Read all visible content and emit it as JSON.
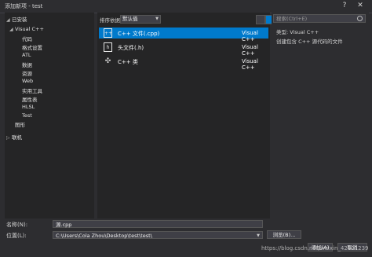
{
  "window": {
    "title": "添加新项 - test",
    "help_glyph": "?",
    "close_glyph": "✕"
  },
  "tree": {
    "installed": "已安装",
    "visual_cpp": "Visual C++",
    "children": [
      "代码",
      "格式设置",
      "ATL",
      "数据",
      "资源",
      "Web",
      "实用工具",
      "属性表",
      "HLSL",
      "Test"
    ],
    "graphics": "图形",
    "online": "联机"
  },
  "toolbar": {
    "sort_label": "排序依据:",
    "sort_value": "默认值"
  },
  "templates": [
    {
      "icon": "cpp-file-icon",
      "glyph": "++",
      "name": "C++ 文件(.cpp)",
      "type": "Visual C++",
      "selected": true
    },
    {
      "icon": "header-file-icon",
      "glyph": "h",
      "name": "头文件(.h)",
      "type": "Visual C++",
      "selected": false
    },
    {
      "icon": "cpp-class-icon",
      "glyph": "✣",
      "name": "C++ 类",
      "type": "Visual C++",
      "selected": false
    }
  ],
  "search": {
    "placeholder": "搜索(Ctrl+E)"
  },
  "details": {
    "type_line": "类型:  Visual C++",
    "description": "创建包含 C++ 源代码的文件"
  },
  "form": {
    "name_label": "名称(N):",
    "name_value": "源.cpp",
    "location_label": "位置(L):",
    "location_value": "C:\\Users\\Cola Zhou\\Desktop\\test\\test\\",
    "browse_label": "浏览(B)...",
    "add_label": "添加(A)",
    "cancel_label": "取消"
  },
  "watermark": "https://blog.csdn.net/weixin_42521239"
}
